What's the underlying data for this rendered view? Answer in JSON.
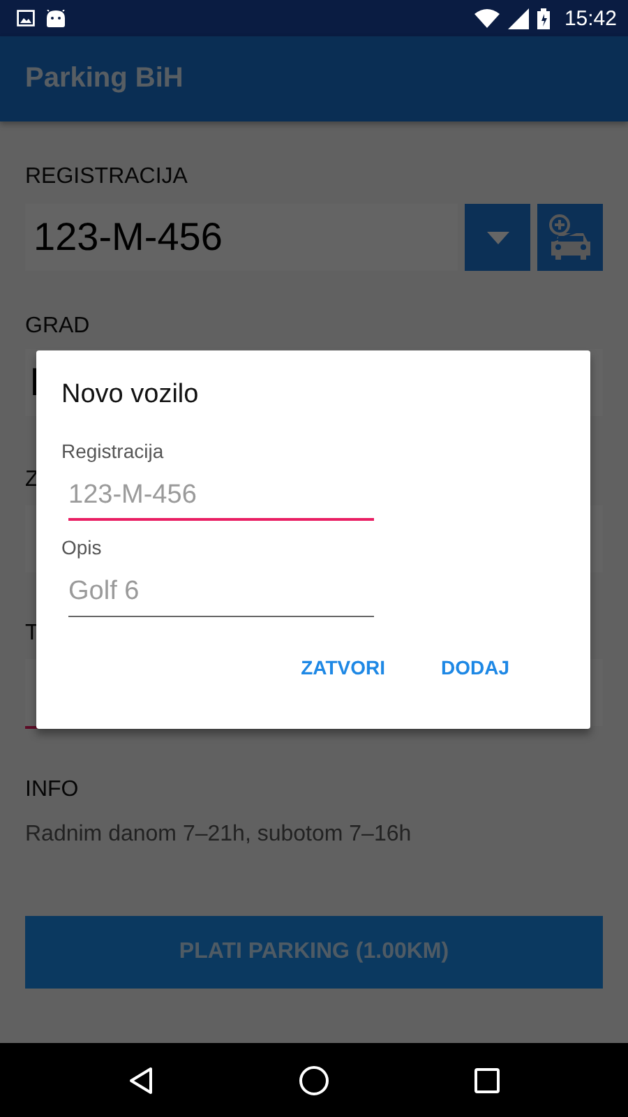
{
  "status_bar": {
    "time": "15:42"
  },
  "app_bar": {
    "title": "Parking BiH"
  },
  "form": {
    "registration": {
      "label": "REGISTRACIJA",
      "value": "123-M-456"
    },
    "city": {
      "label": "GRAD",
      "value": "I"
    },
    "zone": {
      "label": "Z"
    },
    "time": {
      "label": "T",
      "focused": true
    },
    "info": {
      "label": "INFO",
      "text": "Radnim danom 7–21h, subotom 7–16h"
    },
    "pay_button": "PLATI PARKING (1.00KM)"
  },
  "dialog": {
    "title": "Novo vozilo",
    "fields": [
      {
        "label": "Registracija",
        "placeholder": "123-M-456",
        "focused": true
      },
      {
        "label": "Opis",
        "placeholder": "Golf 6",
        "focused": false
      }
    ],
    "buttons": [
      "ZATVORI",
      "DODAJ"
    ]
  }
}
